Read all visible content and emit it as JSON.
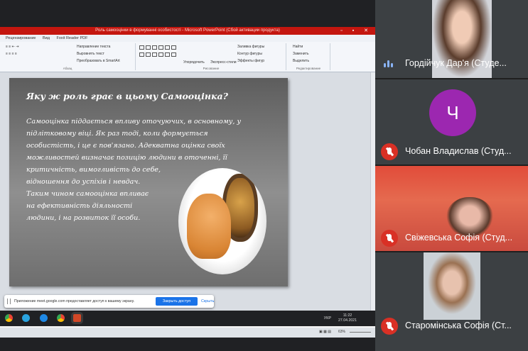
{
  "ppt": {
    "window_title": "Роль самооцінки в формуванні особистості - Microsoft PowerPoint (Сбой активации продукта)",
    "tabs": [
      "Рецензирование",
      "Вид",
      "Foxit Reader PDF"
    ],
    "ribbon": {
      "paragraph_items": [
        "Направление текста",
        "Выровнять текст",
        "Преобразовать в SmartArt"
      ],
      "paragraph_label": "Абзац",
      "arrange_label": "Упорядочить",
      "quick_styles_label": "Экспресс-стили",
      "drawing_items": [
        "Заливка фигуры",
        "Контур фигуры",
        "Эффекты фигур"
      ],
      "drawing_label": "Рисование",
      "editing_items": [
        "Найти",
        "Заменить",
        "Выделить"
      ],
      "editing_label": "Редактирование"
    },
    "slide": {
      "title": "Яку ж роль грає в цьому Самооцінка?",
      "lines": [
        "Самооцінка піддається впливу оточуючих, в основному, у",
        "підлітковому віці. Як раз тоді, коли формується",
        "особистість, і це є пов'язано. Адекватна оцінка своїх",
        "можливостей визначає  позицію людини в оточенні, її",
        "критичність, вимогливість до себе,",
        "відношення до успіхів і невдач.",
        "Таким чином самооцінка впливає",
        "на ефективність діяльності",
        "людини, і на розвиток її особи."
      ]
    },
    "zoom": "63%"
  },
  "share_bar": {
    "text": "Приложение meet.google.com предоставляет доступ к вашему экрану.",
    "stop_label": "Закрыть доступ",
    "hide_label": "Скрыть"
  },
  "taskbar": {
    "lang": "УКР",
    "time": "11:22",
    "date": "27.04.2021",
    "icons": [
      "chrome-icon",
      "telegram-icon",
      "skype-icon",
      "chrome-icon",
      "powerpoint-icon"
    ]
  },
  "participants": [
    {
      "name": "Гордійчук Дар'я (Студе...",
      "muted": false,
      "speaking": true
    },
    {
      "name": "Чобан Владислав (Студ...",
      "muted": true,
      "avatar_letter": "Ч",
      "avatar_color": "#9c27b0"
    },
    {
      "name": "Свіжевська Софія (Студ...",
      "muted": true
    },
    {
      "name": "Старомінська Софія (Ст...",
      "muted": true
    }
  ]
}
